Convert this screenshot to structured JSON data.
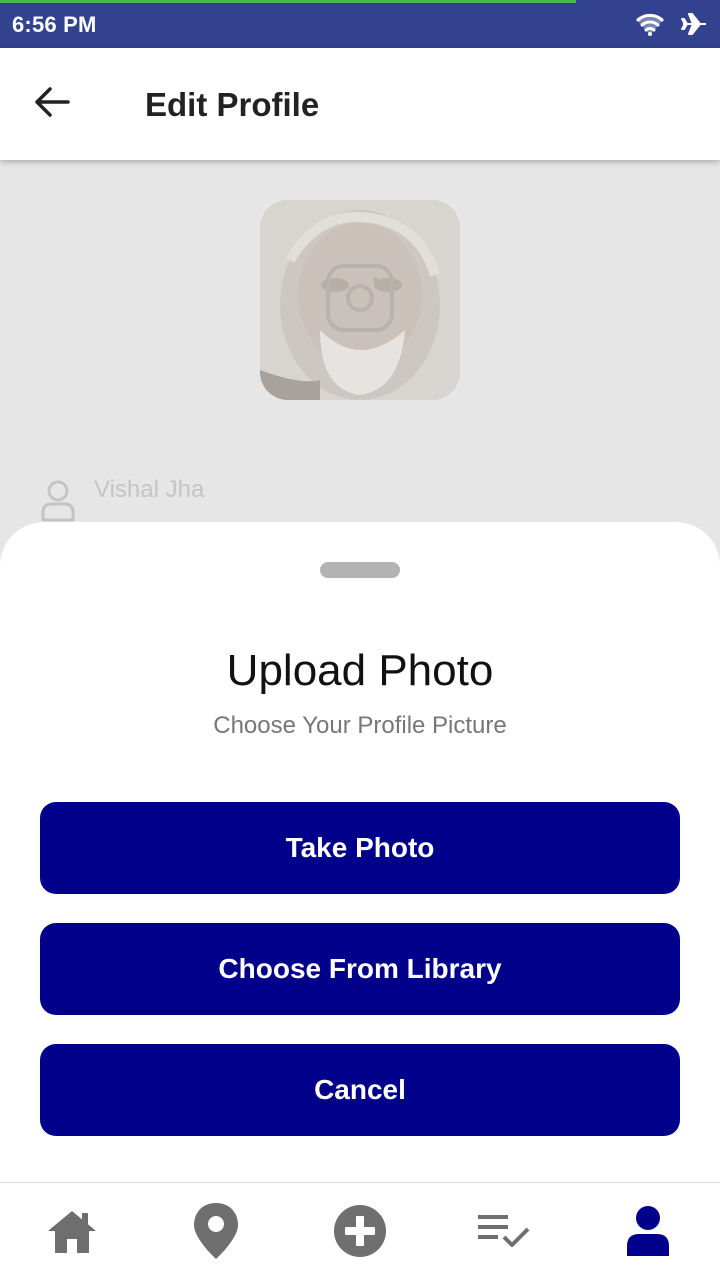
{
  "status_bar": {
    "time": "6:56 PM",
    "icons": [
      "wifi-icon",
      "airplane-icon"
    ]
  },
  "app_bar": {
    "title": "Edit Profile",
    "back_icon": "arrow-left-icon"
  },
  "profile": {
    "name": "Vishal Jha"
  },
  "sheet": {
    "title": "Upload Photo",
    "subtitle": "Choose Your Profile Picture",
    "buttons": {
      "take_photo": "Take Photo",
      "choose_library": "Choose From Library",
      "cancel": "Cancel"
    }
  },
  "bottom_nav": {
    "items": [
      "home-icon",
      "location-pin-icon",
      "add-circle-icon",
      "checklist-icon",
      "profile-icon"
    ],
    "active": "profile-icon"
  },
  "colors": {
    "status_bar": "#33428f",
    "progress": "#49b84a",
    "primary_button": "#00008b",
    "nav_active": "#00008b",
    "nav_inactive": "#6f6f6f"
  }
}
